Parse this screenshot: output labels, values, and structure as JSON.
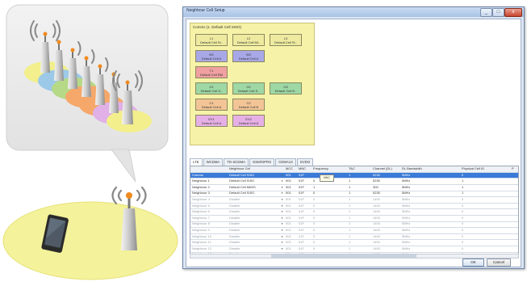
{
  "window": {
    "title": "Neighbour Cell Setup",
    "minimize": "_",
    "maximize": "□",
    "close": "x"
  },
  "comms": {
    "title": "Comms (1. Default Cell SISO)",
    "cells": [
      {
        "label": "L1",
        "sub": "Default Cell SI..",
        "color": "yellow"
      },
      {
        "label": "L2",
        "sub": "Default Cell MI..",
        "color": "yellow"
      },
      {
        "label": "L3",
        "sub": "Default Cell SI..",
        "color": "yellow"
      },
      {
        "label": "W1",
        "sub": "Default Cell A",
        "color": "blue"
      },
      {
        "label": "W2",
        "sub": "Default Cell A",
        "color": "blue"
      },
      {
        "label": "T1",
        "sub": "Default Cell RM",
        "color": "red"
      },
      {
        "label": "G1",
        "sub": "Default Cell S..",
        "color": "green"
      },
      {
        "label": "G2",
        "sub": "Default Cell S..",
        "color": "green"
      },
      {
        "label": "G3",
        "sub": "Default Cell E..",
        "color": "green"
      },
      {
        "label": "C1",
        "sub": "Default Cell A",
        "color": "orange"
      },
      {
        "label": "C2",
        "sub": "Default Cell B",
        "color": "orange"
      },
      {
        "label": "EV1",
        "sub": "Default Cell A",
        "color": "pink"
      },
      {
        "label": "EV2",
        "sub": "Default Cell A",
        "color": "pink"
      }
    ]
  },
  "tabs": [
    "LTE",
    "WCDMA",
    "TD-SCDMA",
    "GSM/GPRS",
    "CDMA1X",
    "EVDO"
  ],
  "grid": {
    "headers": [
      "",
      "Neighbour Cell",
      "MCC",
      "MNC",
      "Frequency",
      "TAC",
      "Channel (DL)",
      "DL Bandwidth",
      "Physical Cell ID",
      "P"
    ],
    "rows": [
      {
        "name": "Comms",
        "cell": "Default Cell SISO",
        "mcc": "001",
        "mnc": "01F",
        "freq": "",
        "tac": "1",
        "ch": "5230",
        "bw": "5MHz",
        "pci": "0",
        "style": "sel"
      },
      {
        "name": "Neighbour 1",
        "cell": "Default Cell SISO",
        "mcc": "001",
        "mnc": "01F",
        "freq": "0",
        "tac": "1",
        "ch": "5230",
        "bw": "5MHz",
        "pci": "1",
        "style": ""
      },
      {
        "name": "Neighbour 2",
        "cell": "Default Cell MIMO",
        "mcc": "001",
        "mnc": "01F",
        "freq": "1",
        "tac": "1",
        "ch": "300",
        "bw": "5MHz",
        "pci": "1",
        "style": ""
      },
      {
        "name": "Neighbour 3",
        "cell": "Default Cell SISO",
        "mcc": "001",
        "mnc": "01F",
        "freq": "0",
        "tac": "1",
        "ch": "5230",
        "bw": "5MHz",
        "pci": "1",
        "style": ""
      },
      {
        "name": "Neighbour 4",
        "cell": "Disable",
        "mcc": "001",
        "mnc": "01F",
        "freq": "0",
        "tac": "1",
        "ch": "1400",
        "bw": "5MHz",
        "pci": "0",
        "style": "dim"
      },
      {
        "name": "Neighbour 5",
        "cell": "Disable",
        "mcc": "001",
        "mnc": "01F",
        "freq": "0",
        "tac": "1",
        "ch": "1400",
        "bw": "5MHz",
        "pci": "0",
        "style": "dim"
      },
      {
        "name": "Neighbour 6",
        "cell": "Disable",
        "mcc": "001",
        "mnc": "01F",
        "freq": "0",
        "tac": "1",
        "ch": "1400",
        "bw": "5MHz",
        "pci": "0",
        "style": "dim"
      },
      {
        "name": "Neighbour 7",
        "cell": "Disable",
        "mcc": "001",
        "mnc": "01F",
        "freq": "0",
        "tac": "1",
        "ch": "1400",
        "bw": "5MHz",
        "pci": "0",
        "style": "dim"
      },
      {
        "name": "Neighbour 8",
        "cell": "Disable",
        "mcc": "001",
        "mnc": "01F",
        "freq": "0",
        "tac": "1",
        "ch": "1400",
        "bw": "5MHz",
        "pci": "0",
        "style": "dim"
      },
      {
        "name": "Neighbour 9",
        "cell": "Disable",
        "mcc": "001",
        "mnc": "01F",
        "freq": "0",
        "tac": "1",
        "ch": "1400",
        "bw": "5MHz",
        "pci": "0",
        "style": "dim"
      },
      {
        "name": "Neighbour 10",
        "cell": "Disable",
        "mcc": "001",
        "mnc": "01F",
        "freq": "0",
        "tac": "1",
        "ch": "1400",
        "bw": "5MHz",
        "pci": "0",
        "style": "dim"
      },
      {
        "name": "Neighbour 11",
        "cell": "Disable",
        "mcc": "001",
        "mnc": "01F",
        "freq": "0",
        "tac": "1",
        "ch": "1400",
        "bw": "5MHz",
        "pci": "0",
        "style": "dim"
      },
      {
        "name": "Neighbour 12",
        "cell": "Disable",
        "mcc": "001",
        "mnc": "01F",
        "freq": "0",
        "tac": "1",
        "ch": "1400",
        "bw": "5MHz",
        "pci": "0",
        "style": "dim"
      },
      {
        "name": "Neighbour 13",
        "cell": "Disable",
        "mcc": "001",
        "mnc": "01F",
        "freq": "0",
        "tac": "1",
        "ch": "1400",
        "bw": "5MHz",
        "pci": "0",
        "style": "dim"
      }
    ],
    "tooltip": "MNC"
  },
  "buttons": {
    "ok": "OK",
    "cancel": "Cancel"
  },
  "colors": {
    "accent": "#3a7ad8",
    "comms_bg": "#f6f2a8",
    "illus_yellow": "#f2ef8c",
    "antenna_orange": "#f08a1e"
  }
}
